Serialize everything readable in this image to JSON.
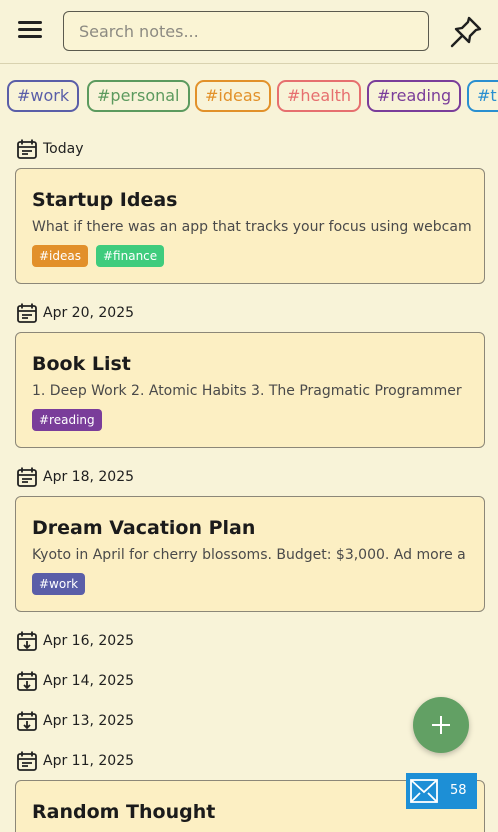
{
  "header": {
    "menu_icon": "hamburger-menu-icon",
    "search_placeholder": "Search notes...",
    "search_value": "",
    "pin_icon": "pin-icon"
  },
  "tag_filters": [
    {
      "label": "#work",
      "color": "#5a5ea8"
    },
    {
      "label": "#personal",
      "color": "#5c9a5e"
    },
    {
      "label": "#ideas",
      "color": "#e2912a"
    },
    {
      "label": "#health",
      "color": "#e66f6f"
    },
    {
      "label": "#reading",
      "color": "#7a3d9a"
    },
    {
      "label": "#t",
      "color": "#2a8fd0"
    }
  ],
  "timeline": [
    {
      "date": "Today",
      "icon": "calendar-icon",
      "note": {
        "title": "Startup Ideas",
        "body": "What if there was an app that tracks your focus using webcam AI?",
        "tags": [
          {
            "label": "#ideas",
            "color": "#e2902a"
          },
          {
            "label": "#finance",
            "color": "#3fcc7d"
          }
        ]
      }
    },
    {
      "date": "Apr 20, 2025",
      "icon": "calendar-icon",
      "note": {
        "title": "Book List",
        "body": "1. Deep Work 2. Atomic Habits 3. The Pragmatic Programmer",
        "tags": [
          {
            "label": "#reading",
            "color": "#7a3d9a"
          }
        ]
      }
    },
    {
      "date": "Apr 18, 2025",
      "icon": "calendar-icon",
      "note": {
        "title": "Dream Vacation Plan",
        "body": "Kyoto in April for cherry blossoms. Budget: $3,000. Ad more a",
        "tags": [
          {
            "label": "#work",
            "color": "#5a5ea8"
          }
        ]
      }
    },
    {
      "date": "Apr 16, 2025",
      "icon": "calendar-download-icon"
    },
    {
      "date": "Apr 14, 2025",
      "icon": "calendar-download-icon"
    },
    {
      "date": "Apr 13, 2025",
      "icon": "calendar-download-icon"
    },
    {
      "date": "Apr 11, 2025",
      "icon": "calendar-icon",
      "note": {
        "title": "Random Thought",
        "body": "",
        "tags": []
      }
    }
  ],
  "fab": {
    "icon": "plus-icon",
    "color": "#62a064"
  },
  "badge": {
    "icon": "mail-icon",
    "count": "58",
    "color": "#1d8fd6"
  }
}
